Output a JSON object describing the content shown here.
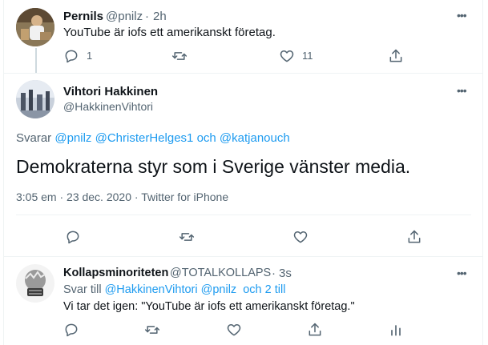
{
  "tweet1": {
    "author": "Pernils",
    "handle": "@pnilz",
    "dot": "·",
    "time": "2h",
    "text": "YouTube är iofs ett amerikanskt företag.",
    "reply_count": "1",
    "like_count": "11",
    "more": "•••"
  },
  "tweet2": {
    "author": "Vihtori Hakkinen",
    "handle": "@HakkinenVihtori",
    "reply_prefix": "Svarar",
    "reply_user1": "@pnilz",
    "reply_user2": "@ChristerHelges1",
    "reply_and": "och",
    "reply_user3": "@katjanouch",
    "text": "Demokraterna styr som i Sverige vänster media.",
    "timestamp": "3:05 em · 23 dec. 2020 · ",
    "source": "Twitter for iPhone",
    "more": "•••"
  },
  "tweet3": {
    "author": "Kollapsminoriteten",
    "handle": "@TOTALKOLLAPS",
    "dot": "·",
    "time": "3s",
    "reply_prefix": "Svar till",
    "reply_user1": "@HakkinenVihtori",
    "reply_user2": "@pnilz",
    "reply_more": " och 2 till",
    "text": "Vi tar det igen: \"YouTube är iofs ett amerikanskt företag.\"",
    "more": "•••"
  },
  "icons": {
    "reply": "reply-icon",
    "retweet": "retweet-icon",
    "like": "like-icon",
    "share": "share-icon",
    "analytics": "analytics-icon"
  },
  "colors": {
    "accent": "#1d9bf0",
    "muted": "#536471",
    "text": "#0f1419"
  }
}
